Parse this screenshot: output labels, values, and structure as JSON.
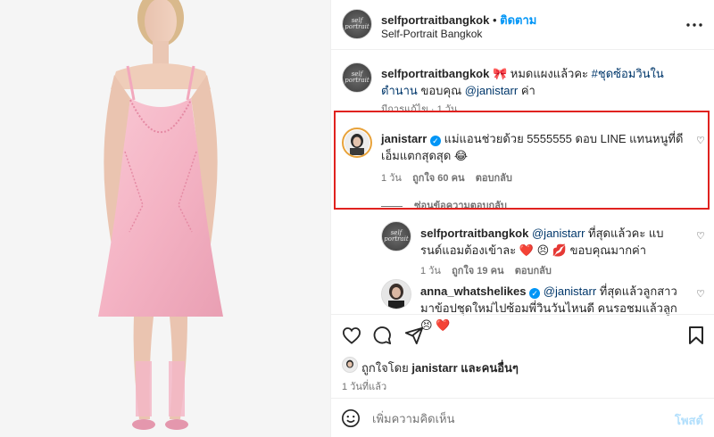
{
  "header": {
    "username": "selfportraitbangkok",
    "follow_label": "ติดตาม",
    "display_name": "Self-Portrait Bangkok",
    "more_icon": "more-horizontal-icon",
    "avatar_text": "self portrait"
  },
  "caption": {
    "username": "selfportraitbangkok",
    "text_before": "🎀 หมดแผงแล้วคะ ",
    "hashtag": "#ชุดซ้อมวินในตำนาน",
    "text_mid": " ขอบคุณ ",
    "mention": "@janistarr",
    "text_after": " ค่า",
    "meta": "มีการแก้ไข · 1 วัน"
  },
  "comment_main": {
    "username": "janistarr",
    "verified": true,
    "text": "แม่แอนช่วยด้วย 5555555 ดอบ LINE แทนหนูที่ดีเอ็มแตกสุดสุด 😂",
    "time": "1 วัน",
    "likes": "ถูกใจ 60 คน",
    "reply_label": "ตอบกลับ",
    "hide_replies": "ซ่อนข้อความตอบกลับ"
  },
  "replies": [
    {
      "username": "selfportraitbangkok",
      "mention": "@janistarr",
      "text": " ที่สุดแล้วคะ แบรนด์แอมต้องเข้าละ ❤️ 😣 💋 ขอบคุณมากค่า",
      "time": "1 วัน",
      "likes": "ถูกใจ 19 คน",
      "reply_label": "ตอบกลับ"
    },
    {
      "username": "anna_whatshelikes",
      "verified": true,
      "mention": "@janistarr",
      "text": " ที่สุดแล้วลูกสาว มาข้อปชุดใหม่ไปซ้อมพี่วินวันไหนดี คนรอชมแล้วลูก 😣 ❤️"
    }
  ],
  "actions": {
    "like_icon": "heart-outline-icon",
    "comment_icon": "comment-icon",
    "share_icon": "send-icon",
    "save_icon": "bookmark-icon"
  },
  "likes_line": {
    "prefix": "ถูกใจโดย ",
    "user": "janistarr",
    "suffix": " และคนอื่นๆ"
  },
  "post_time": "1 วันที่แล้ว",
  "comment_box": {
    "placeholder": "เพิ่มความคิดเห็น",
    "post_label": "โพสต์",
    "emoji_icon": "smiley-icon"
  },
  "colors": {
    "accent": "#0095f6",
    "highlight": "#e0221f",
    "dress": "#f4b8c8"
  }
}
